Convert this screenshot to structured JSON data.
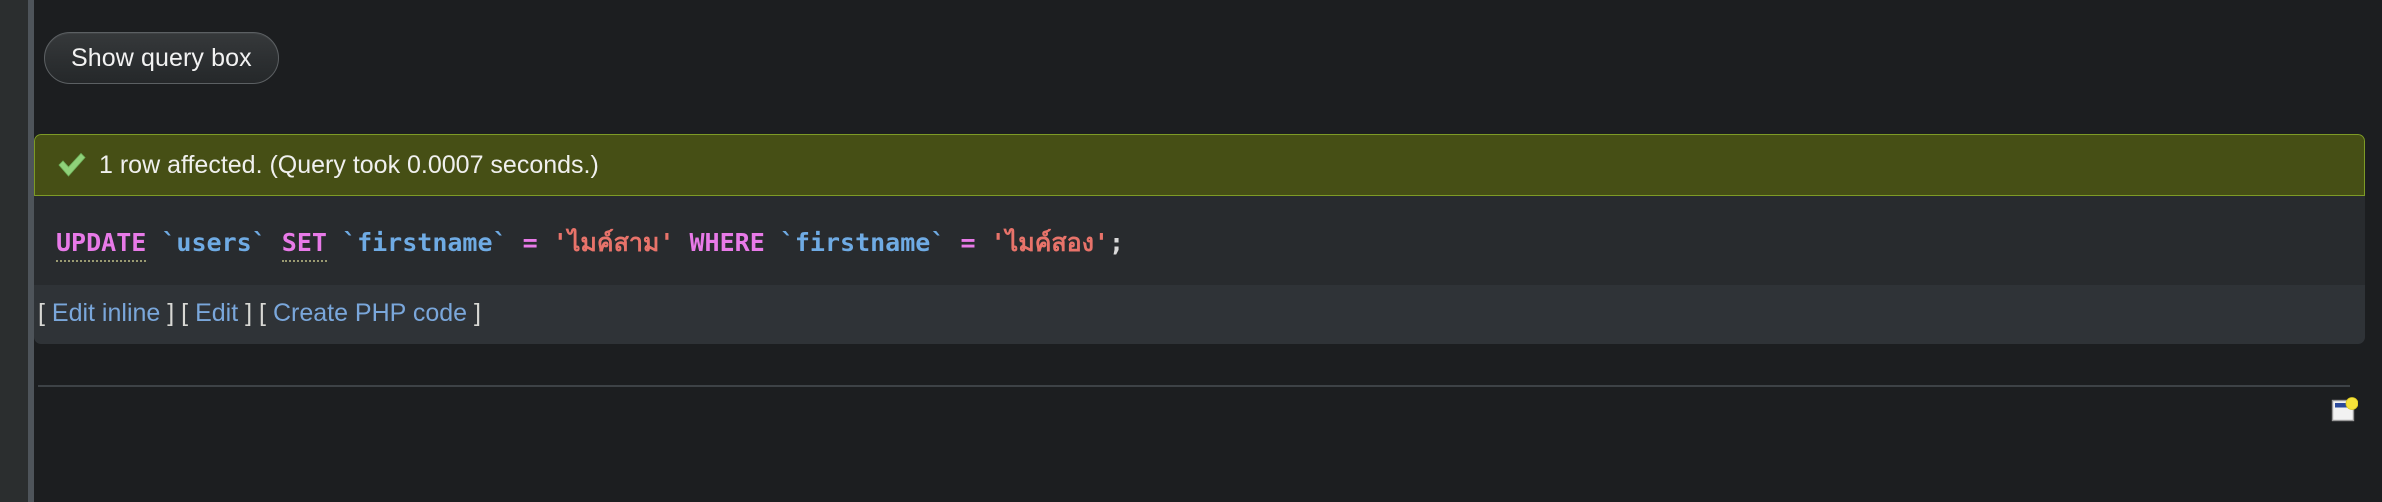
{
  "toolbar": {
    "show_query_box_label": "Show query box"
  },
  "result": {
    "status_icon": "green-check-icon",
    "status_text": "1 row affected. (Query took 0.0007 seconds.)",
    "rows_affected": "1",
    "query_time_seconds": "0.0007",
    "sql": {
      "full_text": "UPDATE `users` SET `firstname` = 'ไมค์สาม' WHERE `firstname` = 'ไมค์สอง';",
      "tokens": {
        "kw_update": "UPDATE",
        "table": "`users`",
        "kw_set": "SET",
        "col_set": "`firstname`",
        "eq1": "=",
        "val_new": "'ไมค์สาม'",
        "kw_where": "WHERE",
        "col_where": "`firstname`",
        "eq2": "=",
        "val_old": "'ไมค์สอง'",
        "semicolon": ";"
      }
    },
    "actions": {
      "open_bracket": "[",
      "close_bracket": "]",
      "edit_inline": "Edit inline",
      "edit": "Edit",
      "create_php_code": "Create PHP code"
    }
  },
  "footer": {
    "window_icon_name": "new-window-icon"
  },
  "colors": {
    "page_background": "#1c1e20",
    "panel_background": "#282b2e",
    "success_background": "#464f15",
    "success_border": "#7d9b26",
    "links_background": "#2f3337",
    "link_color": "#7aa7db",
    "sql_keyword": "#e87ae8",
    "sql_identifier": "#6fabe4",
    "sql_string": "#e8736a",
    "rail_background": "#2b2e2f",
    "rail_divider": "#4e545a"
  }
}
